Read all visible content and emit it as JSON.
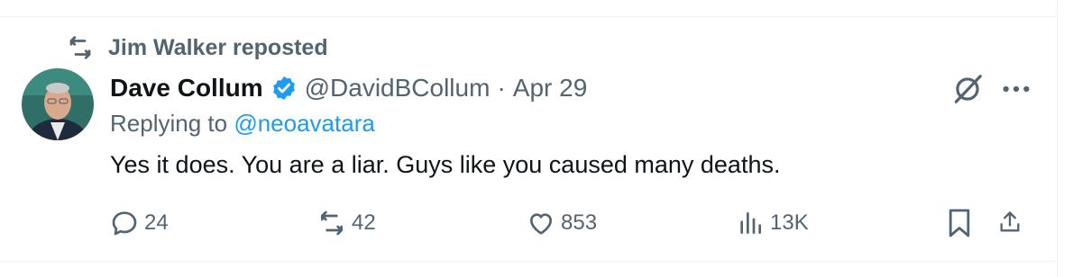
{
  "repost": {
    "text": "Jim Walker reposted",
    "icon": "repost-icon"
  },
  "tweet": {
    "author_name": "Dave Collum",
    "verified": true,
    "handle": "@DavidBCollum",
    "separator": "·",
    "date": "Apr 29",
    "replying_prefix": "Replying to",
    "replying_mention": "@neoavatara",
    "text": "Yes it does. You are a liar. Guys like you caused many deaths."
  },
  "actions": {
    "replies": "24",
    "reposts": "42",
    "likes": "853",
    "views": "13K"
  },
  "colors": {
    "accent": "#1d9bf0",
    "muted": "#536471",
    "text": "#0f1419"
  }
}
